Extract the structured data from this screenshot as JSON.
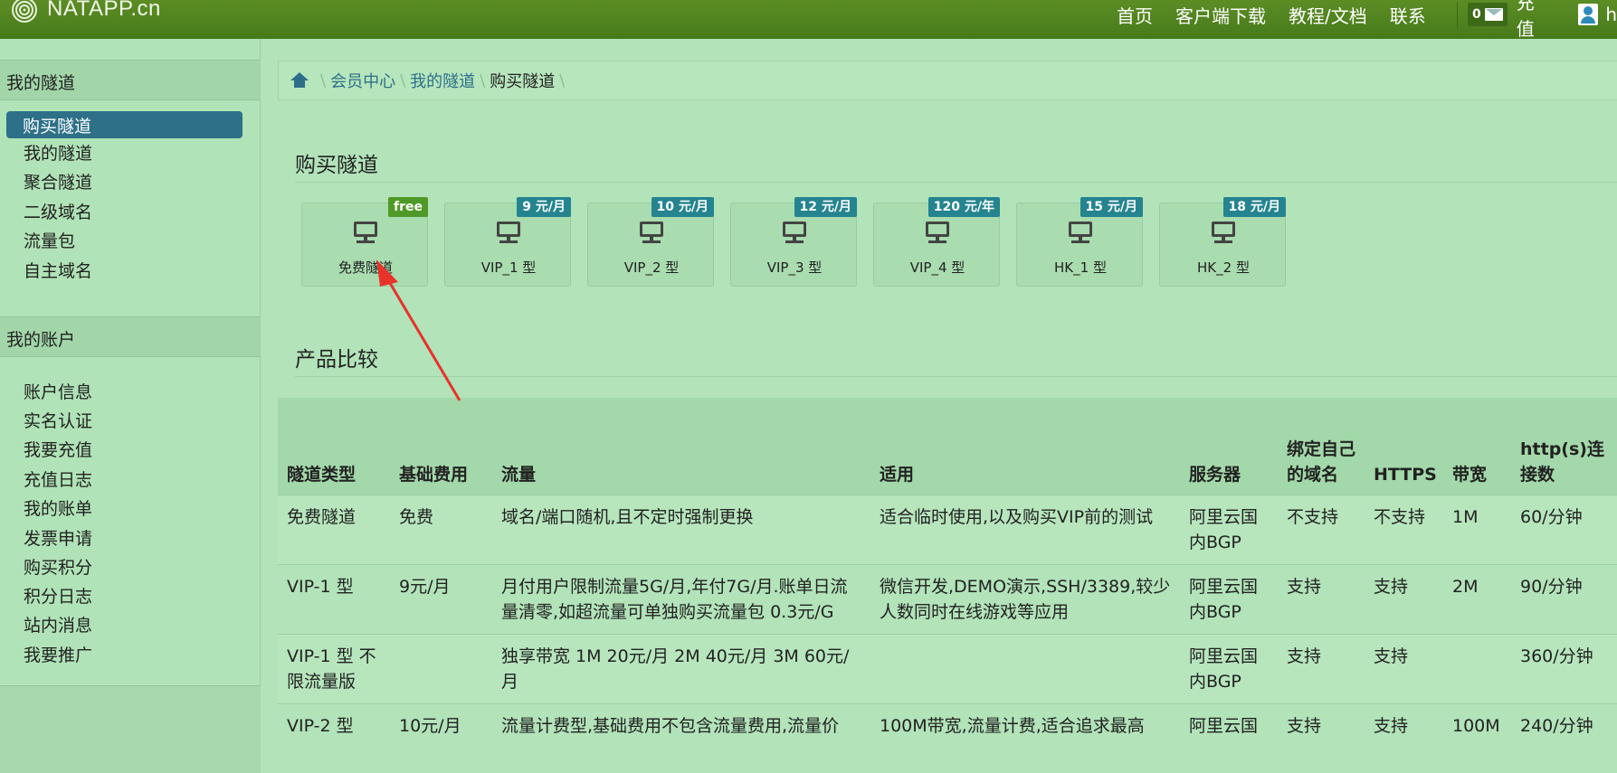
{
  "header": {
    "brand": "NATAPP.cn",
    "nav": [
      "首页",
      "客户端下载",
      "教程/文档",
      "联系"
    ],
    "message_count": "0",
    "recharge_label": "充值",
    "username": "h"
  },
  "sidebar": {
    "groups": [
      {
        "title": "我的隧道",
        "items": [
          "购买隧道",
          "我的隧道",
          "聚合隧道",
          "二级域名",
          "流量包",
          "自主域名"
        ],
        "active": "购买隧道"
      },
      {
        "title": "我的账户",
        "items": [
          "账户信息",
          "实名认证",
          "我要充值",
          "充值日志",
          "我的账单",
          "发票申请",
          "购买积分",
          "积分日志",
          "站内消息",
          "我要推广"
        ]
      }
    ]
  },
  "breadcrumb": [
    "会员中心",
    "我的隧道",
    "购买隧道"
  ],
  "buy_section": {
    "title": "购买隧道",
    "tiles": [
      {
        "label": "免费隧道",
        "price": "free"
      },
      {
        "label": "VIP_1 型",
        "price": "9 元/月"
      },
      {
        "label": "VIP_2 型",
        "price": "10 元/月"
      },
      {
        "label": "VIP_3 型",
        "price": "12 元/月"
      },
      {
        "label": "VIP_4 型",
        "price": "120 元/年"
      },
      {
        "label": "HK_1 型",
        "price": "15 元/月"
      },
      {
        "label": "HK_2 型",
        "price": "18 元/月"
      }
    ]
  },
  "compare_section": {
    "title": "产品比较",
    "headers": [
      "隧道类型",
      "基础费用",
      "流量",
      "适用",
      "服务器",
      "绑定自己的域名",
      "HTTPS",
      "带宽",
      "http(s)连接数"
    ],
    "rows": [
      [
        "免费隧道",
        "免费",
        "域名/端口随机,且不定时强制更换",
        "适合临时使用,以及购买VIP前的测试",
        "阿里云国内BGP",
        "不支持",
        "不支持",
        "1M",
        "60/分钟"
      ],
      [
        "VIP-1 型",
        "9元/月",
        "月付用户限制流量5G/月,年付7G/月.账单日流量清零,如超流量可单独购买流量包 0.3元/G",
        "微信开发,DEMO演示,SSH/3389,较少人数同时在线游戏等应用",
        "阿里云国内BGP",
        "支持",
        "支持",
        "2M",
        "90/分钟"
      ],
      [
        "VIP-1 型 不限流量版",
        "",
        "独享带宽 1M 20元/月 2M 40元/月 3M 60元/月",
        "",
        "阿里云国内BGP",
        "支持",
        "支持",
        "",
        "360/分钟"
      ],
      [
        "VIP-2 型",
        "10元/月",
        "流量计费型,基础费用不包含流量费用,流量价",
        "100M带宽,流量计费,适合追求最高",
        "阿里云国",
        "支持",
        "支持",
        "100M",
        "240/分钟"
      ]
    ]
  },
  "colors": {
    "navbar": "#4f8320",
    "active_menu": "#2d7088",
    "page_bg": "#b2e3b9",
    "price_badge": "#24848f",
    "free_badge": "#4f9a26",
    "arrow": "#e8322a"
  }
}
